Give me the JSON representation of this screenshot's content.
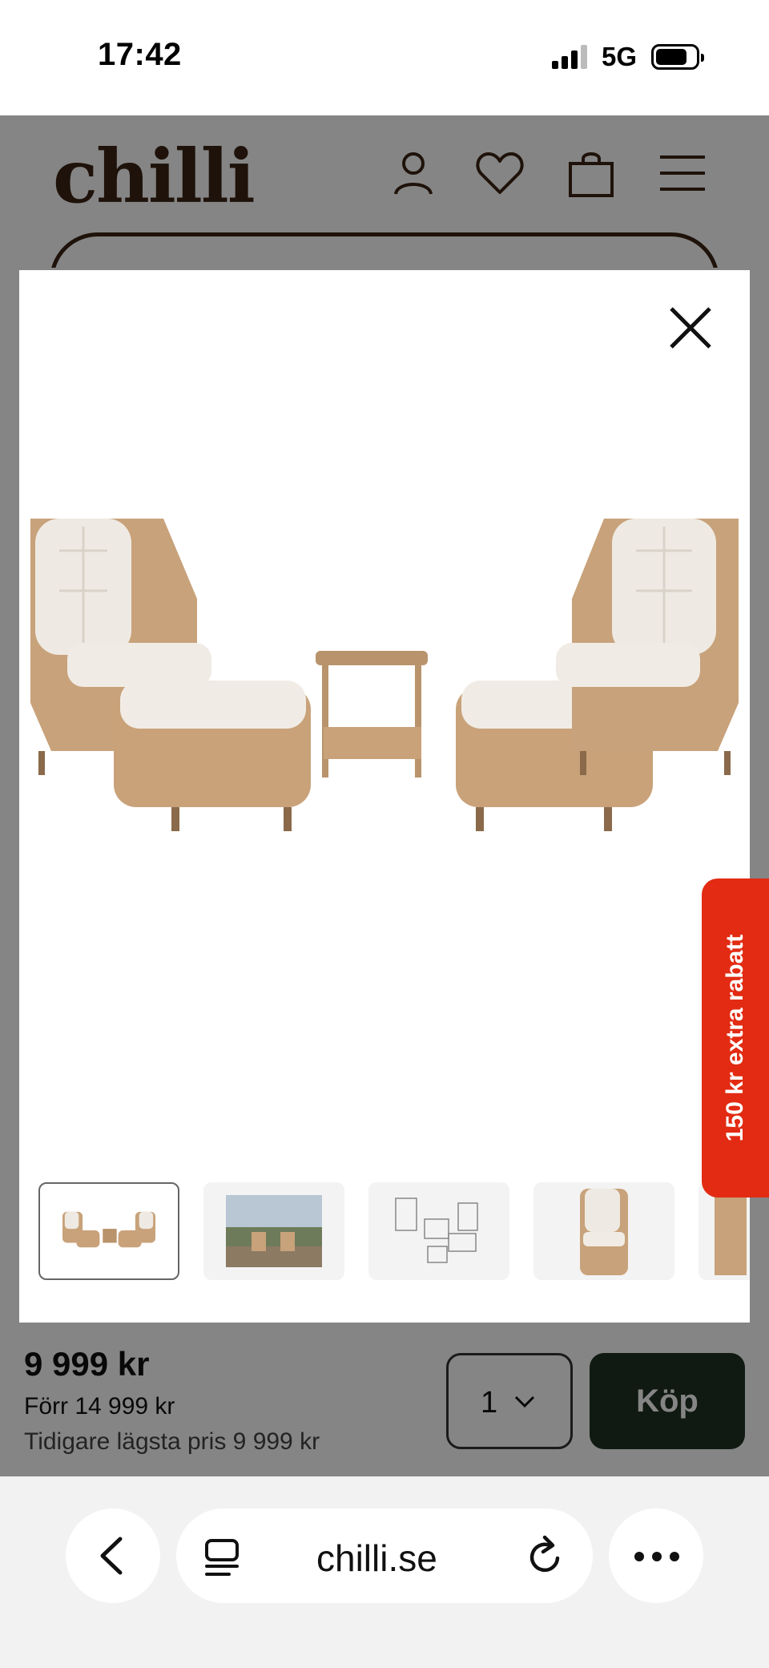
{
  "status_bar": {
    "time": "17:42",
    "network": "5G"
  },
  "site": {
    "logo_text": "chilli",
    "brand_color": "#3b2414",
    "icons": [
      "account-icon",
      "heart-icon",
      "bag-icon",
      "menu-icon"
    ]
  },
  "gallery": {
    "close_icon": "close-icon",
    "main_image": "rattan-lounge-set-product-photo",
    "thumbnails": [
      {
        "name": "thumb-product-set",
        "active": true
      },
      {
        "name": "thumb-lifestyle-photo",
        "active": false
      },
      {
        "name": "thumb-dimension-drawing",
        "active": false
      },
      {
        "name": "thumb-single-chair",
        "active": false
      },
      {
        "name": "thumb-partial",
        "active": false
      }
    ]
  },
  "promo": {
    "label": "150 kr extra rabatt",
    "color": "#e22b12"
  },
  "product": {
    "price": "9 999 kr",
    "previous_price": "Förr 14 999 kr",
    "lowest_price": "Tidigare lägsta pris 9 999 kr",
    "quantity": "1",
    "buy_label": "Köp",
    "buy_color": "#1f3324"
  },
  "browser": {
    "url": "chilli.se",
    "icons": [
      "back-icon",
      "reader-icon",
      "reload-icon",
      "more-icon"
    ]
  }
}
